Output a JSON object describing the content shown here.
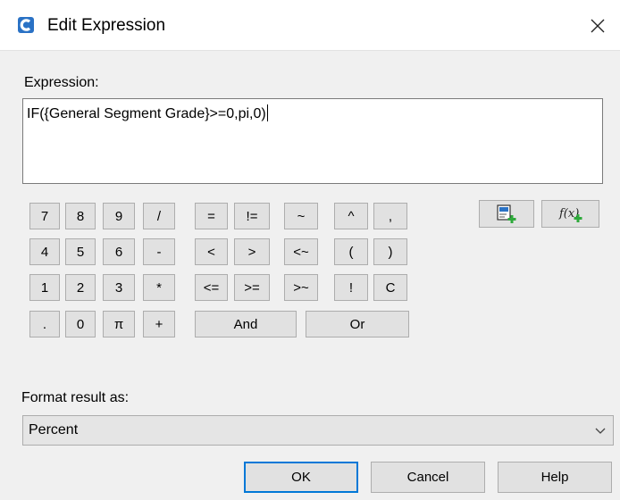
{
  "window": {
    "title": "Edit Expression"
  },
  "expression": {
    "label": "Expression:",
    "value": "IF({General Segment Grade}>=0,pi,0)"
  },
  "keypad": {
    "rows": [
      [
        "7",
        "8",
        "9",
        "/",
        "=",
        "!=",
        "~",
        "^",
        ","
      ],
      [
        "4",
        "5",
        "6",
        "-",
        "<",
        ">",
        "<~",
        "(",
        ")"
      ],
      [
        "1",
        "2",
        "3",
        "*",
        "<=",
        ">=",
        ">~",
        "!",
        "C"
      ],
      [
        ".",
        "0",
        "π",
        "+",
        "And",
        "Or"
      ]
    ]
  },
  "tools": {
    "insert_property_icon": "insert-property-icon",
    "insert_function_icon": "insert-function-icon"
  },
  "format": {
    "label": "Format result as:",
    "selected": "Percent"
  },
  "footer": {
    "ok_label": "OK",
    "cancel_label": "Cancel",
    "help_label": "Help"
  },
  "colors": {
    "accent": "#0078d7",
    "app_icon": "#2a72c5",
    "add_green": "#2eaa3b"
  }
}
